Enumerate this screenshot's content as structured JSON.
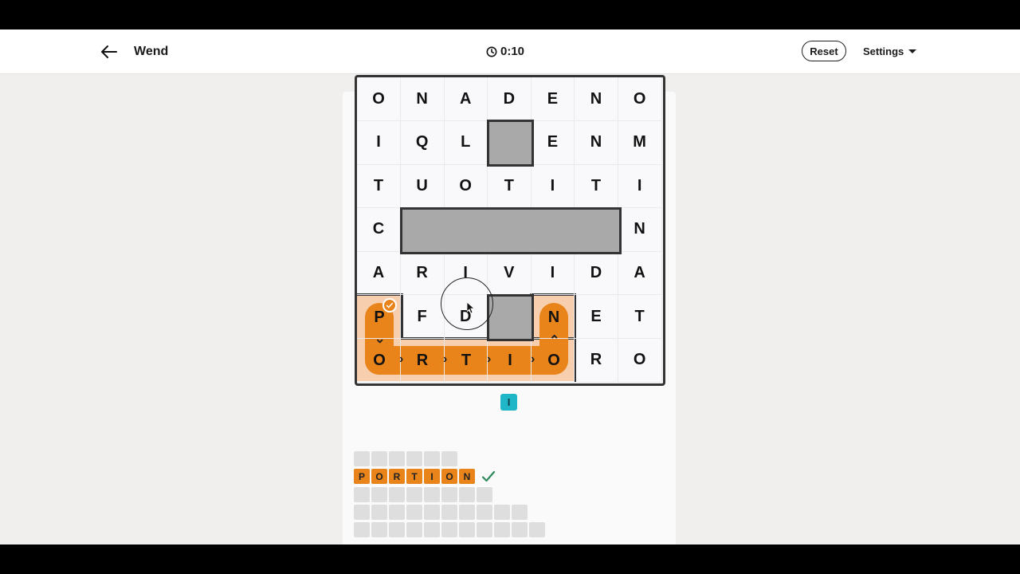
{
  "header": {
    "title": "Wend",
    "timer": "0:10",
    "reset_label": "Reset",
    "settings_label": "Settings"
  },
  "grid": {
    "rows": [
      [
        "O",
        "N",
        "A",
        "D",
        "E",
        "N",
        "O"
      ],
      [
        "I",
        "Q",
        "L",
        "",
        "E",
        "N",
        "M"
      ],
      [
        "T",
        "U",
        "O",
        "T",
        "I",
        "T",
        "I"
      ],
      [
        "C",
        "",
        "",
        "",
        "",
        "",
        "N"
      ],
      [
        "A",
        "R",
        "I",
        "V",
        "I",
        "D",
        "A"
      ],
      [
        "",
        "F",
        "D",
        "",
        "",
        "E",
        "T"
      ],
      [
        "",
        "",
        "",
        "",
        "",
        "R",
        "O"
      ]
    ]
  },
  "found_path": {
    "letters": [
      "P",
      "O",
      "R",
      "T",
      "I",
      "O",
      "N"
    ],
    "color": "#e8841a",
    "region_color": "#f7ceae"
  },
  "hint_letter": "I",
  "word_slots": {
    "row1_count": 6,
    "found_word": [
      "P",
      "O",
      "R",
      "T",
      "I",
      "O",
      "N"
    ],
    "row3_count": 8,
    "row4_count": 10,
    "row5_count": 11
  },
  "colors": {
    "accent": "#e8841a",
    "hint": "#1fb7c8",
    "check": "#2f8a5a"
  }
}
